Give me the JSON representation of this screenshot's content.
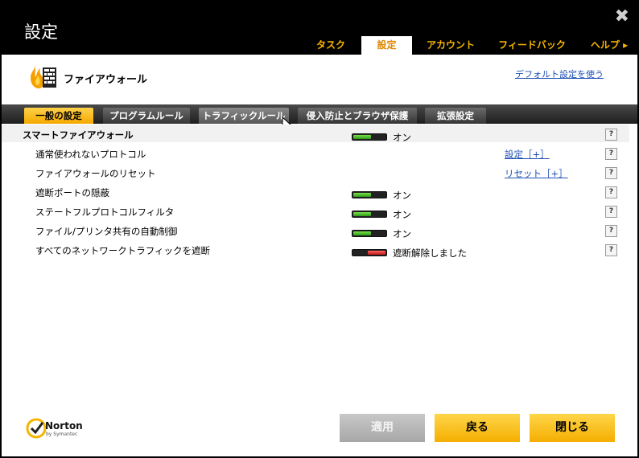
{
  "window": {
    "title": "設定",
    "close_label": "✖"
  },
  "top_tabs": [
    {
      "label": "タスク",
      "active": false
    },
    {
      "label": "設定",
      "active": true
    },
    {
      "label": "アカウント",
      "active": false
    },
    {
      "label": "フィードバック",
      "active": false
    },
    {
      "label": "ヘルプ ▸",
      "active": false
    }
  ],
  "section": {
    "title": "ファイアウォール",
    "default_link": "デフォルト設定を使う"
  },
  "sub_tabs": [
    {
      "label": "一般の設定",
      "active": true
    },
    {
      "label": "プログラムルール",
      "active": false
    },
    {
      "label": "トラフィックルール",
      "active": false,
      "hover": true
    },
    {
      "label": "侵入防止とブラウザ保護",
      "active": false
    },
    {
      "label": "拡張設定",
      "active": false
    }
  ],
  "settings": [
    {
      "label": "スマートファイアウォール",
      "bold": true,
      "toggle": "on",
      "state": "オン",
      "link": ""
    },
    {
      "label": "通常使われないプロトコル",
      "bold": false,
      "toggle": "",
      "state": "",
      "link": "設定［+］"
    },
    {
      "label": "ファイアウォールのリセット",
      "bold": false,
      "toggle": "",
      "state": "",
      "link": "リセット［+］"
    },
    {
      "label": "遮断ポートの隠蔽",
      "bold": false,
      "toggle": "on",
      "state": "オン",
      "link": ""
    },
    {
      "label": "ステートフルプロトコルフィルタ",
      "bold": false,
      "toggle": "on",
      "state": "オン",
      "link": ""
    },
    {
      "label": "ファイル/プリンタ共有の自動制御",
      "bold": false,
      "toggle": "on",
      "state": "オン",
      "link": ""
    },
    {
      "label": "すべてのネットワークトラフィックを遮断",
      "bold": false,
      "toggle": "off",
      "state": "遮断解除しました",
      "link": ""
    }
  ],
  "help_label": "?",
  "footer": {
    "logo_text": "Norton",
    "logo_sub": "by Symantec",
    "apply_label": "適用",
    "back_label": "戻る",
    "close_label": "閉じる"
  },
  "colors": {
    "accent": "#f7b500",
    "link": "#1f4fb4",
    "toggle_on": "#3cb521",
    "toggle_off": "#d42020"
  }
}
